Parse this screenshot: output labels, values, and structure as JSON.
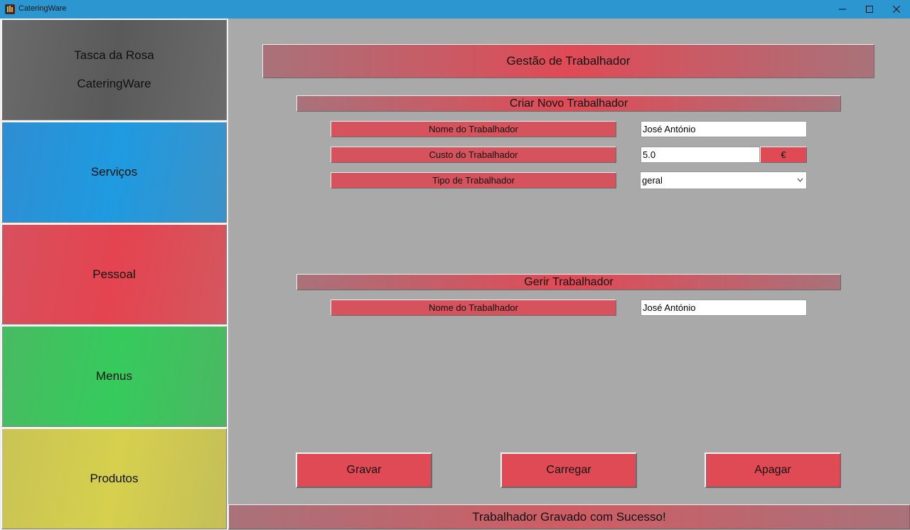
{
  "window": {
    "title": "CateringWare",
    "controls": {
      "minimize_icon": "minimize-icon",
      "maximize_icon": "maximize-icon",
      "close_icon": "close-icon"
    }
  },
  "sidebar": {
    "brand": {
      "line1": "Tasca da Rosa",
      "line2": "CateringWare"
    },
    "items": [
      {
        "label": "Serviços",
        "color": "#1f9ae0"
      },
      {
        "label": "Pessoal",
        "color": "#e4444f"
      },
      {
        "label": "Menus",
        "color": "#36ca5c"
      },
      {
        "label": "Produtos",
        "color": "#d6d04e"
      }
    ]
  },
  "main": {
    "page_title": "Gestão de Trabalhador",
    "create_section": {
      "title": "Criar Novo Trabalhador",
      "name_label": "Nome do Trabalhador",
      "name_value": "José António",
      "cost_label": "Custo do Trabalhador",
      "cost_value": "5.0",
      "currency": "€",
      "type_label": "Tipo de Trabalhador",
      "type_value": "geral"
    },
    "manage_section": {
      "title": "Gerir Trabalhador",
      "name_label": "Nome do Trabalhador",
      "name_value": "José António"
    },
    "actions": {
      "save": "Gravar",
      "load": "Carregar",
      "delete": "Apagar"
    },
    "status": "Trabalhador Gravado com Sucesso!"
  },
  "colors": {
    "accent_red": "#e04a55",
    "titlebar": "#2b96cf",
    "background": "#a9a9a9"
  }
}
